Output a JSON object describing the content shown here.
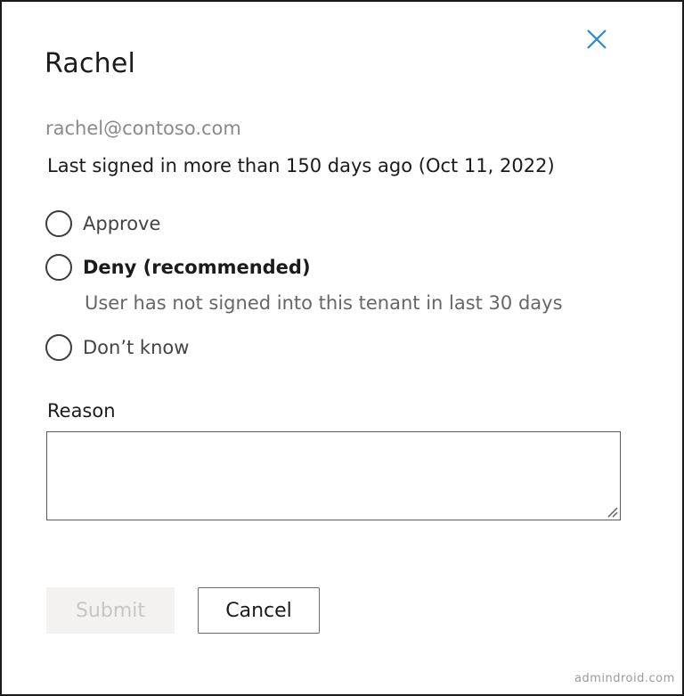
{
  "dialog": {
    "title": "Rachel",
    "email": "rachel@contoso.com",
    "last_signed": "Last signed in more than 150 days ago (Oct 11, 2022)",
    "options": [
      {
        "label": "Approve",
        "selected": false
      },
      {
        "label": "Deny (recommended)",
        "selected": false,
        "hint": "User has not signed into this tenant in last 30 days"
      },
      {
        "label": "Don’t know",
        "selected": false
      }
    ],
    "reason_label": "Reason",
    "reason_value": "",
    "submit_label": "Submit",
    "cancel_label": "Cancel",
    "close_icon": "close-icon"
  },
  "watermark": "admindroid.com",
  "colors": {
    "close_icon": "#2b88d8",
    "submit_bg": "#f3f2f1",
    "submit_text": "#c8c6c4"
  }
}
